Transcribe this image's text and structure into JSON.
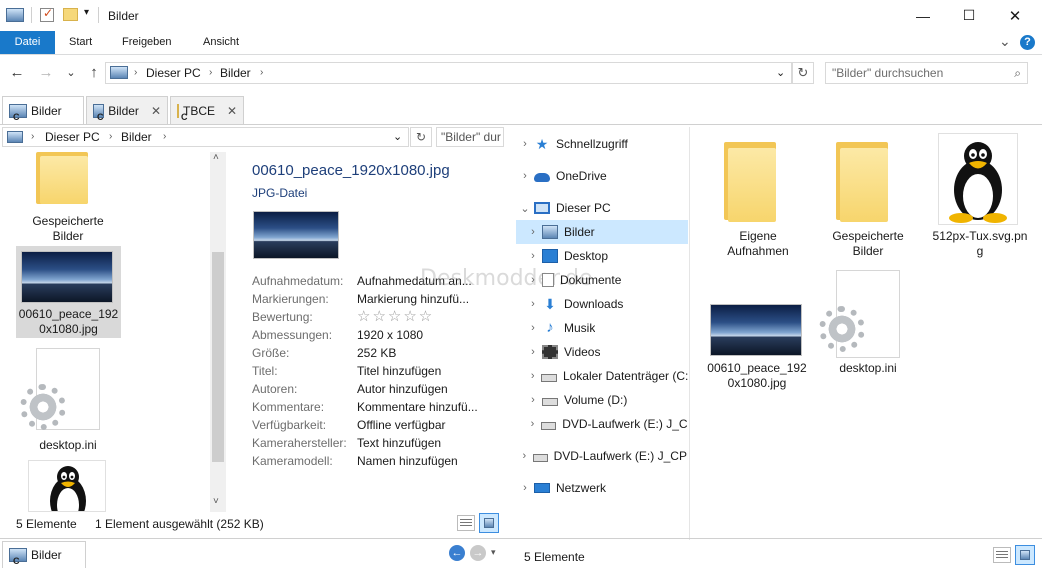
{
  "window": {
    "title": "Bilder",
    "minimize_glyph": "—",
    "maximize_glyph": "☐",
    "close_glyph": "✕",
    "help_glyph": "?",
    "expand_glyph": "⌄"
  },
  "ribbon": {
    "tabs": [
      "Datei",
      "Start",
      "Freigeben",
      "Ansicht"
    ]
  },
  "address": {
    "crumbs": [
      "Dieser PC",
      "Bilder"
    ],
    "search_placeholder": "\"Bilder\" durchsuchen"
  },
  "tabs": [
    {
      "label": "Bilder",
      "letter": "C",
      "icon": "pictures-icon"
    },
    {
      "label": "Bilder",
      "letter": "C",
      "icon": "pictures-icon"
    },
    {
      "label": "TBCE",
      "letter": "C",
      "icon": "folder-icon"
    }
  ],
  "tab_close": "✕",
  "pane_left": {
    "crumbs": [
      "Dieser PC",
      "Bilder"
    ],
    "search_placeholder": "\"Bilder\" dur",
    "items": [
      {
        "label_line1": "Gespeicherte",
        "label_line2": "Bilder",
        "type": "folder"
      },
      {
        "label_line1": "00610_peace_192",
        "label_line2": "0x1080.jpg",
        "type": "photo"
      },
      {
        "label_line1": "desktop.ini",
        "label_line2": "",
        "type": "settings-file"
      },
      {
        "label_line1": "",
        "label_line2": "",
        "type": "tux"
      }
    ],
    "status_count": "5 Elemente",
    "status_selected": "1 Element ausgewählt (252 KB)"
  },
  "details": {
    "filename": "00610_peace_1920x1080.jpg",
    "filetype": "JPG-Datei",
    "properties": [
      {
        "key": "Aufnahmedatum:",
        "value": "Aufnahmedatum an..."
      },
      {
        "key": "Markierungen:",
        "value": "Markierung hinzufü..."
      },
      {
        "key": "Bewertung:",
        "value": "☆☆☆☆☆"
      },
      {
        "key": "Abmessungen:",
        "value": "1920 x 1080"
      },
      {
        "key": "Größe:",
        "value": "252 KB"
      },
      {
        "key": "Titel:",
        "value": "Titel hinzufügen"
      },
      {
        "key": "Autoren:",
        "value": "Autor hinzufügen"
      },
      {
        "key": "Kommentare:",
        "value": "Kommentare hinzufü..."
      },
      {
        "key": "Verfügbarkeit:",
        "value": "Offline verfügbar"
      },
      {
        "key": "Kamerahersteller:",
        "value": "Text hinzufügen"
      },
      {
        "key": "Kameramodell:",
        "value": "Namen hinzufügen"
      }
    ]
  },
  "watermark": "Deskmodder.de",
  "nav_tree": [
    {
      "label": "Schnellzugriff",
      "icon": "star-icon",
      "arrow": "›"
    },
    {
      "label": "OneDrive",
      "icon": "cloud-icon",
      "arrow": "›"
    },
    {
      "label": "Dieser PC",
      "icon": "computer-icon",
      "arrow": "⌄"
    },
    {
      "label": "Bilder",
      "icon": "pictures-icon",
      "arrow": "›"
    },
    {
      "label": "Desktop",
      "icon": "desktop-icon",
      "arrow": "›"
    },
    {
      "label": "Dokumente",
      "icon": "documents-icon",
      "arrow": "›"
    },
    {
      "label": "Downloads",
      "icon": "downloads-icon",
      "arrow": "›"
    },
    {
      "label": "Musik",
      "icon": "music-icon",
      "arrow": "›"
    },
    {
      "label": "Videos",
      "icon": "videos-icon",
      "arrow": "›"
    },
    {
      "label": "Lokaler Datenträger (C:)",
      "icon": "drive-icon",
      "arrow": "›"
    },
    {
      "label": "Volume (D:)",
      "icon": "drive-icon",
      "arrow": "›"
    },
    {
      "label": "DVD-Laufwerk (E:) J_CP",
      "icon": "dvd-icon",
      "arrow": "›"
    },
    {
      "label": "DVD-Laufwerk (E:) J_CPR/",
      "icon": "dvd-icon",
      "arrow": "›"
    },
    {
      "label": "Netzwerk",
      "icon": "network-icon",
      "arrow": "›"
    }
  ],
  "pane_right": {
    "items": [
      {
        "label_line1": "Eigene",
        "label_line2": "Aufnahmen",
        "type": "folder"
      },
      {
        "label_line1": "Gespeicherte",
        "label_line2": "Bilder",
        "type": "folder"
      },
      {
        "label_line1": "512px-Tux.svg.pn",
        "label_line2": "g",
        "type": "tux"
      },
      {
        "label_line1": "00610_peace_192",
        "label_line2": "0x1080.jpg",
        "type": "photo"
      },
      {
        "label_line1": "desktop.ini",
        "label_line2": "",
        "type": "settings-file"
      }
    ],
    "status_count": "5 Elemente"
  },
  "bottom_tab": {
    "label": "Bilder",
    "letter": "C"
  },
  "colors": {
    "accent": "#1979ca",
    "selection": "#cce8ff",
    "selected_tile": "#d9d9d9"
  }
}
